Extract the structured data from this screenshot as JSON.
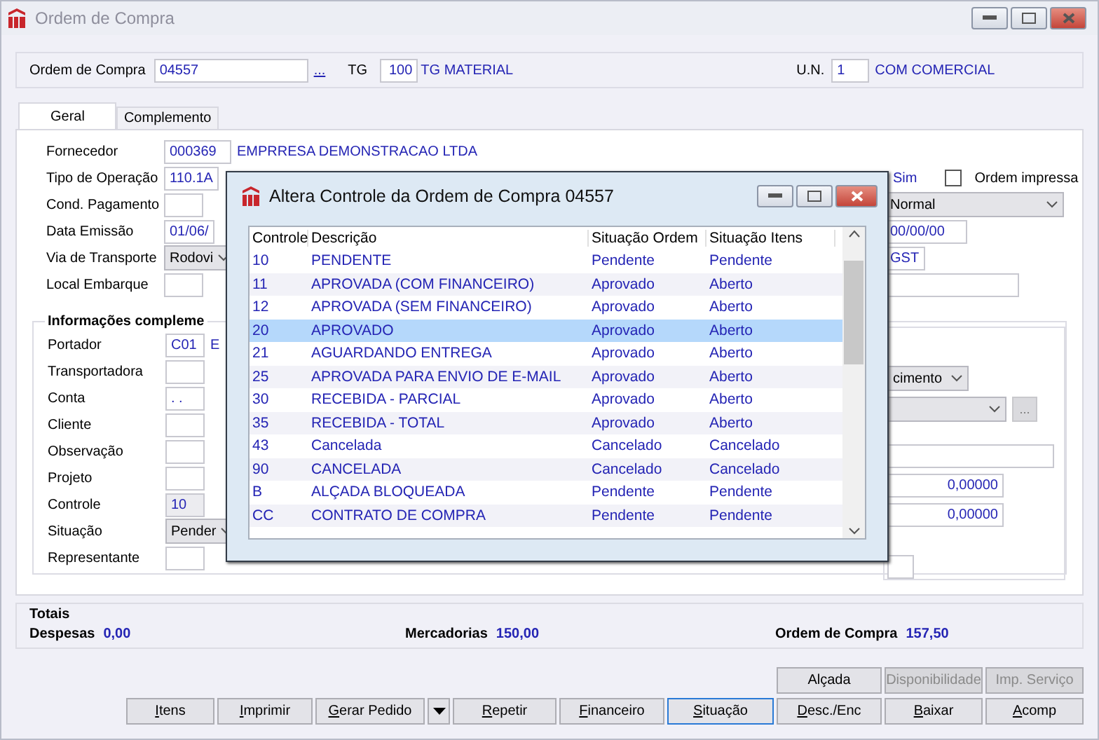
{
  "window": {
    "title": "Ordem de Compra"
  },
  "header": {
    "order_label": "Ordem de Compra",
    "order_value": "04557",
    "lookup": "...",
    "tg_label": "TG",
    "tg_value": "100",
    "tg_name": "TG MATERIAL",
    "un_label": "U.N.",
    "un_value": "1",
    "un_name": "COM COMERCIAL"
  },
  "tabs": [
    {
      "label": "Geral",
      "selected": true
    },
    {
      "label": "Complemento",
      "selected": false
    }
  ],
  "general": {
    "left": [
      {
        "label": "Fornecedor",
        "kind": "input",
        "value": "000369",
        "text": "EMPRRESA DEMONSTRACAO LTDA"
      },
      {
        "label": "Tipo de Operação",
        "kind": "input",
        "value": "110.1A"
      },
      {
        "label": "Cond. Pagamento",
        "kind": "input"
      },
      {
        "label": "Data Emissão",
        "kind": "input",
        "value": "01/06/"
      },
      {
        "label": "Via de Transporte",
        "kind": "select",
        "value": "Rodovi"
      },
      {
        "label": "Local Embarque",
        "kind": "input"
      }
    ],
    "right": [
      {
        "kind": "spacer"
      },
      {
        "kind": "checkrow",
        "value": "Sim",
        "label": "Ordem impressa",
        "checked": false
      },
      {
        "kind": "select",
        "value": "Normal"
      },
      {
        "kind": "input",
        "value": "00/00/00"
      },
      {
        "kind": "input",
        "value": "GST"
      },
      {
        "kind": "input"
      }
    ]
  },
  "group": {
    "title": "Informações compleme",
    "left": [
      {
        "label": "Portador",
        "kind": "input",
        "value": "C01",
        "text": "E"
      },
      {
        "label": "Transportadora",
        "kind": "input"
      },
      {
        "label": "Conta",
        "kind": "input",
        "value": ".  ."
      },
      {
        "label": "Cliente",
        "kind": "input"
      },
      {
        "label": "Observação",
        "kind": "input"
      },
      {
        "label": "Projeto",
        "kind": "input"
      },
      {
        "label": "Controle",
        "kind": "readonly",
        "value": "10"
      },
      {
        "label": "Situação",
        "kind": "select",
        "value": "Pender"
      },
      {
        "label": "Representante",
        "kind": "input"
      }
    ],
    "right": [
      {
        "kind": "select",
        "value": "cimento"
      },
      {
        "kind": "select",
        "button": "..."
      },
      {
        "kind": "input"
      },
      {
        "kind": "number",
        "value": "0,00000"
      },
      {
        "kind": "number",
        "value": "0,00000"
      },
      {
        "kind": "input"
      }
    ]
  },
  "dialog": {
    "title": "Altera Controle da Ordem de Compra 04557",
    "columns": [
      "Controle",
      "Descrição",
      "Situação Ordem",
      "Situação Itens"
    ],
    "rows": [
      {
        "cells": [
          "10",
          "PENDENTE",
          "Pendente",
          "Pendente"
        ],
        "selected": false
      },
      {
        "cells": [
          "11",
          "APROVADA (COM FINANCEIRO)",
          "Aprovado",
          "Aberto"
        ],
        "selected": false
      },
      {
        "cells": [
          "12",
          "APROVADA (SEM FINANCEIRO)",
          "Aprovado",
          "Aberto"
        ],
        "selected": false
      },
      {
        "cells": [
          "20",
          "APROVADO",
          "Aprovado",
          "Aberto"
        ],
        "selected": true
      },
      {
        "cells": [
          "21",
          "AGUARDANDO ENTREGA",
          "Aprovado",
          "Aberto"
        ],
        "selected": false
      },
      {
        "cells": [
          "25",
          "APROVADA PARA ENVIO DE E-MAIL",
          "Aprovado",
          "Aberto"
        ],
        "selected": false
      },
      {
        "cells": [
          "30",
          "RECEBIDA - PARCIAL",
          "Aprovado",
          "Aberto"
        ],
        "selected": false
      },
      {
        "cells": [
          "35",
          "RECEBIDA - TOTAL",
          "Aprovado",
          "Aberto"
        ],
        "selected": false
      },
      {
        "cells": [
          "43",
          "Cancelada",
          "Cancelado",
          "Cancelado"
        ],
        "selected": false
      },
      {
        "cells": [
          "90",
          "CANCELADA",
          "Cancelado",
          "Cancelado"
        ],
        "selected": false
      },
      {
        "cells": [
          "B",
          "ALÇADA BLOQUEADA",
          "Pendente",
          "Pendente"
        ],
        "selected": false
      },
      {
        "cells": [
          "CC",
          "CONTRATO DE COMPRA",
          "Pendente",
          "Pendente"
        ],
        "selected": false
      }
    ]
  },
  "totals": {
    "title": "Totais",
    "items": [
      {
        "label": "Despesas",
        "value": "0,00"
      },
      {
        "label": "Mercadorias",
        "value": "150,00"
      },
      {
        "label": "Ordem de Compra",
        "value": "157,50"
      }
    ]
  },
  "buttons_top": [
    {
      "label": "Alçada",
      "disabled": false
    },
    {
      "label": "Disponibilidade",
      "disabled": true
    },
    {
      "label": "Imp. Serviço",
      "disabled": true
    }
  ],
  "buttons": [
    {
      "kind": "button",
      "label": "Itens",
      "accelerator": true,
      "focused": false
    },
    {
      "kind": "button",
      "label": "Imprimir",
      "accelerator": true,
      "focused": false
    },
    {
      "kind": "button",
      "label": "Gerar Pedido",
      "accelerator": true,
      "focused": false
    },
    {
      "kind": "dropdown"
    },
    {
      "kind": "button",
      "label": "Repetir",
      "accelerator": true,
      "focused": false
    },
    {
      "kind": "button",
      "label": "Financeiro",
      "accelerator": true,
      "focused": false
    },
    {
      "kind": "button",
      "label": "Situação",
      "accelerator": true,
      "focused": true
    },
    {
      "kind": "button",
      "label": "Desc./Enc",
      "accelerator": true,
      "focused": false
    },
    {
      "kind": "button",
      "label": "Baixar",
      "accelerator": true,
      "focused": false
    },
    {
      "kind": "button",
      "label": "Acomp",
      "accelerator": true,
      "focused": false
    }
  ]
}
